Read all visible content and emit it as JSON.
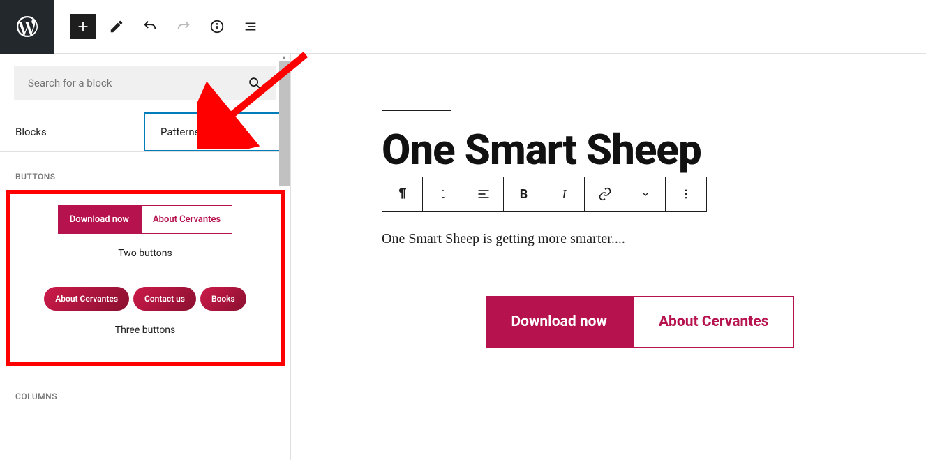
{
  "search": {
    "placeholder": "Search for a block"
  },
  "tabs": {
    "blocks": "Blocks",
    "patterns": "Patterns"
  },
  "sections": {
    "buttons": "BUTTONS",
    "columns": "COLUMNS"
  },
  "patterns": {
    "two": {
      "btn1": "Download now",
      "btn2": "About Cervantes",
      "label": "Two buttons"
    },
    "three": {
      "btn1": "About Cervantes",
      "btn2": "Contact us",
      "btn3": "Books",
      "label": "Three buttons"
    }
  },
  "page": {
    "title": "One Smart Sheep",
    "body": "One Smart Sheep is getting more smarter....",
    "cta1": "Download now",
    "cta2": "About Cervantes"
  }
}
